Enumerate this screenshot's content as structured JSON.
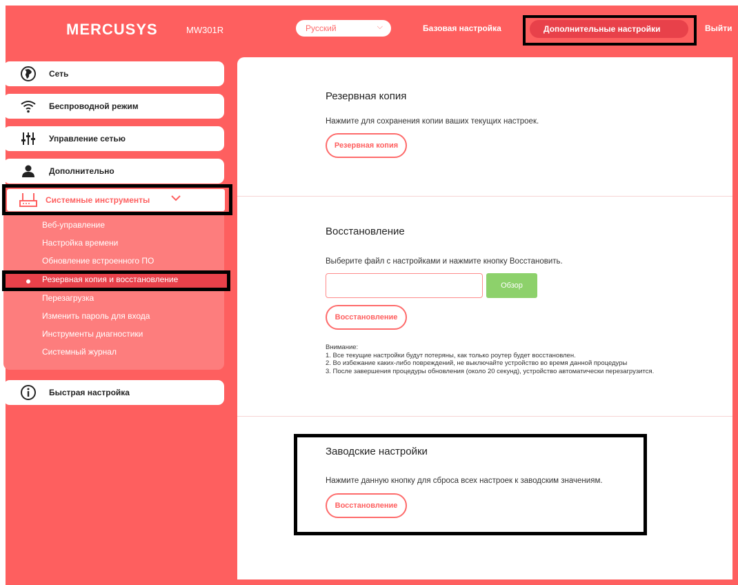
{
  "header": {
    "brand": "MERCUSYS",
    "model": "MW301R",
    "language": "Русский",
    "nav_basic": "Базовая настройка",
    "nav_advanced": "Дополнительные настройки",
    "nav_exit": "Выйти"
  },
  "sidebar": {
    "items": [
      {
        "label": "Сеть",
        "icon": "globe-icon"
      },
      {
        "label": "Беспроводной режим",
        "icon": "wifi-icon"
      },
      {
        "label": "Управление сетью",
        "icon": "sliders-icon"
      },
      {
        "label": "Дополнительно",
        "icon": "user-icon"
      }
    ],
    "tools": {
      "label": "Системные инструменты",
      "icon": "router-icon"
    },
    "submenu": [
      "Веб-управление",
      "Настройка времени",
      "Обновление встроенного ПО",
      "Резервная копия и восстановление",
      "Перезагрузка",
      "Изменить пароль для входа",
      "Инструменты диагностики",
      "Системный журнал"
    ],
    "quick_setup": {
      "label": "Быстрая настройка",
      "icon": "info-icon"
    }
  },
  "backup": {
    "title": "Резервная копия",
    "description": "Нажмите для сохранения копии ваших текущих настроек.",
    "button": "Резервная копия"
  },
  "restore": {
    "title": "Восстановление",
    "description": "Выберите файл с настройками и нажмите кнопку Восстановить.",
    "file_value": "",
    "browse_button": "Обзор",
    "button": "Восстановление",
    "notice_title": "Внимание:",
    "notice_lines": [
      "1. Все текущие настройки будут потеряны, как только роутер будет восстановлен.",
      "2. Во избежание каких-либо повреждений, не выключайте устройство во время данной процедуры",
      "3. После завершения процедуры обновления (около 20 секунд), устройство автоматически перезагрузится."
    ]
  },
  "factory": {
    "title": "Заводские настройки",
    "description": "Нажмите данную кнопку для сброса всех настроек к заводским значениям.",
    "button": "Восстановление"
  },
  "colors": {
    "brand_red": "#fe5f5f",
    "active_red": "#e8414a",
    "browse_green": "#8dd16b"
  }
}
